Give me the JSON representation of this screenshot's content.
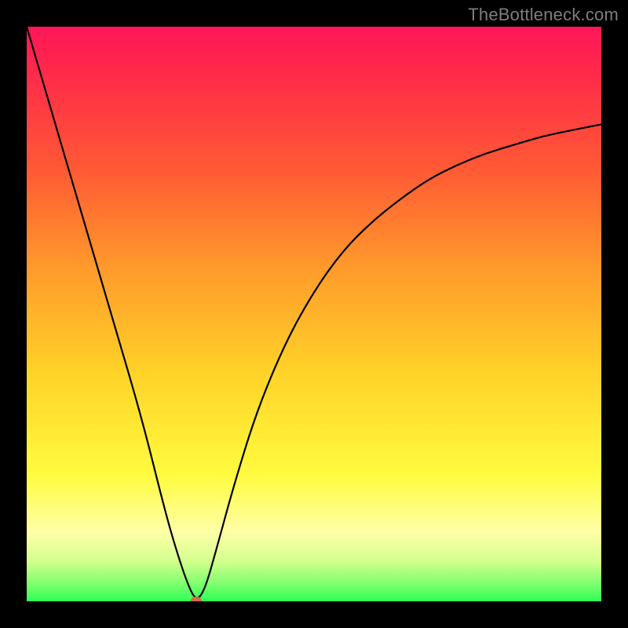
{
  "watermark": {
    "text": "TheBottleneck.com"
  },
  "colors": {
    "pink": "#ff1658",
    "red": "#ff3040",
    "orange": "#ff7a2c",
    "amber": "#ffb129",
    "yellow": "#ffe028",
    "lightyellow": "#ffff70",
    "palegreen": "#b7ff7a",
    "green": "#2eff58",
    "dot": "#d66a4e",
    "curve": "#000000",
    "frame_bg": "#000000"
  },
  "chart_data": {
    "type": "line",
    "title": "",
    "xlabel": "",
    "ylabel": "",
    "xlim": [
      0,
      100
    ],
    "ylim": [
      0,
      100
    ],
    "grid": false,
    "series": [
      {
        "name": "bottleneck-curve",
        "x": [
          0,
          5,
          10,
          15,
          20,
          24,
          26,
          28,
          29.5,
          31,
          33,
          36,
          40,
          45,
          50,
          55,
          60,
          65,
          70,
          75,
          80,
          85,
          90,
          95,
          100
        ],
        "y": [
          100,
          83,
          66,
          49,
          32,
          16,
          9,
          3,
          0,
          2,
          9,
          20,
          33,
          45,
          54,
          61,
          66,
          70,
          73.5,
          76,
          78,
          79.5,
          81,
          82,
          83
        ]
      }
    ],
    "marker": {
      "name": "optimum-point",
      "x": 29.5,
      "y": 0,
      "color": "#d66a4e"
    },
    "background_gradient_stops": [
      {
        "pos": 0.0,
        "color": "#ff1658"
      },
      {
        "pos": 0.08,
        "color": "#ff2a4a"
      },
      {
        "pos": 0.25,
        "color": "#ff5a34"
      },
      {
        "pos": 0.42,
        "color": "#ff9a2b"
      },
      {
        "pos": 0.6,
        "color": "#ffd228"
      },
      {
        "pos": 0.78,
        "color": "#fffb3f"
      },
      {
        "pos": 0.88,
        "color": "#ffffa8"
      },
      {
        "pos": 0.93,
        "color": "#d3ff8e"
      },
      {
        "pos": 0.97,
        "color": "#7dff6d"
      },
      {
        "pos": 1.0,
        "color": "#2eff58"
      }
    ]
  }
}
